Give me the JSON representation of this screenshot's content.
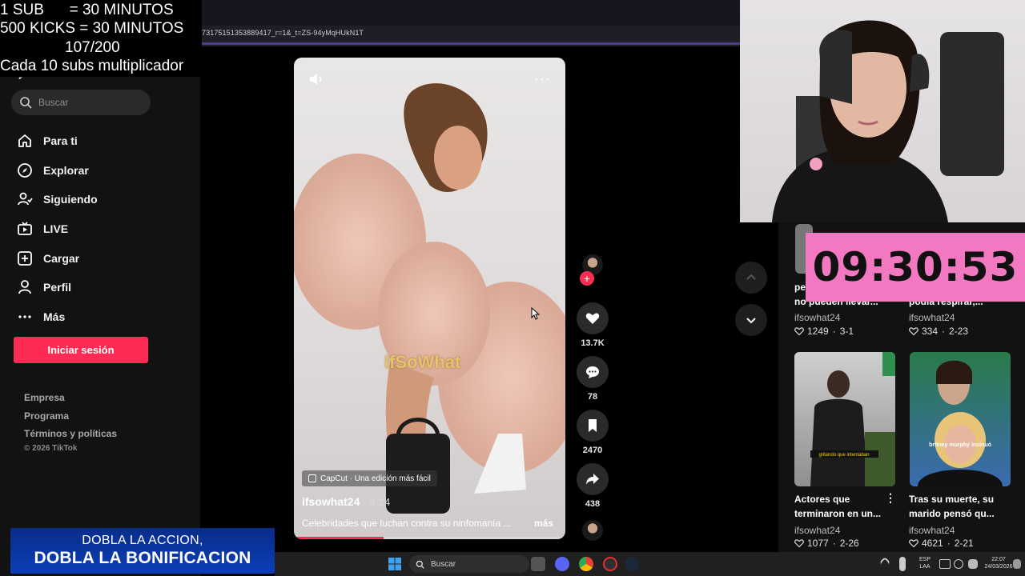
{
  "overlay": {
    "line1": "1 SUB      = 30 MINUTOS",
    "line2": "500 KICKS = 30 MINUTOS",
    "line3": "107/200",
    "line4": "Cada 10 subs multiplicador"
  },
  "browser": {
    "url": "73175151353889417_r=1&_t=ZS-94yMqHUkN1T"
  },
  "sidebar": {
    "search_placeholder": "Buscar",
    "items": [
      {
        "label": "Para ti",
        "icon": "home-icon"
      },
      {
        "label": "Explorar",
        "icon": "compass-icon"
      },
      {
        "label": "Siguiendo",
        "icon": "following-icon"
      },
      {
        "label": "LIVE",
        "icon": "live-icon"
      },
      {
        "label": "Cargar",
        "icon": "upload-icon"
      },
      {
        "label": "Perfil",
        "icon": "profile-icon"
      },
      {
        "label": "Más",
        "icon": "more-icon"
      }
    ],
    "login_label": "Iniciar sesión",
    "footer": [
      "Empresa",
      "Programa",
      "Términos y políticas"
    ],
    "copyright": "© 2026 TikTok"
  },
  "promo": {
    "line1": "DOBLA LA ACCION,",
    "line2": "DOBLA LA BONIFICACION"
  },
  "video": {
    "watermark": "IfSoWhat",
    "capcut": "CapCut · Una edición más fácil",
    "author": "ifsowhat24",
    "date": "· 3-14",
    "caption": "Celebridades que luchan contra su ninfomanía ...",
    "caption_more": "más",
    "progress": 0.33
  },
  "actions": {
    "likes": "13.7K",
    "comments": "78",
    "saves": "2470",
    "shares": "438"
  },
  "grid": {
    "top_row": [
      {
        "title": "no pueden llevar...",
        "title_prefix": "pe",
        "user": "ifsowhat24",
        "views": "1249",
        "date": "3-1"
      },
      {
        "title": "podía respirar,...",
        "user": "ifsowhat24",
        "views": "334",
        "date": "2-23"
      }
    ],
    "bottom_row": [
      {
        "title": "Actores que terminaron en un...",
        "user": "ifsowhat24",
        "views": "1077",
        "date": "2-26",
        "thumb_caption": "gritando que intentaban"
      },
      {
        "title": "Tras su muerte, su marido pensó qu...",
        "user": "ifsowhat24",
        "views": "4621",
        "date": "2-21",
        "thumb_caption": "britney murphy insinuó"
      }
    ]
  },
  "timer": {
    "value": "09:30:53",
    "color": "#f278c1"
  },
  "taskbar": {
    "search_label": "Buscar",
    "lang": "ESP",
    "lang2": "LAA",
    "time": "22:07",
    "date": "24/03/2026"
  },
  "colors": {
    "accent": "#fe2c55",
    "background": "#000000",
    "sidebar": "#121212"
  }
}
